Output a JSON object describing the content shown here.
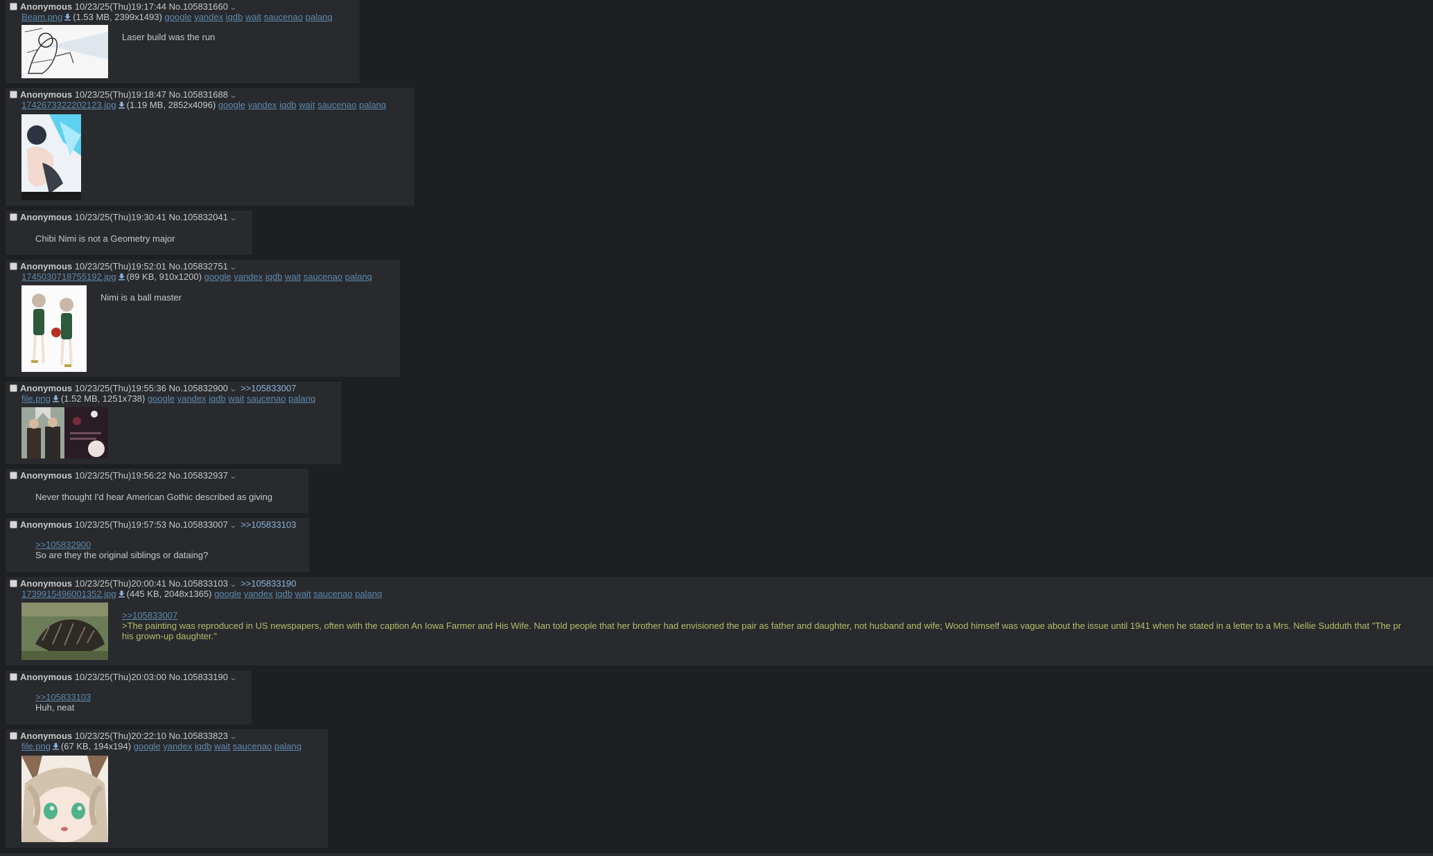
{
  "posts": [
    {
      "name": "Anonymous",
      "datetime": "10/23/25(Thu)19:17:44",
      "number": "No.105831660",
      "file": {
        "filename": "Beam.png",
        "info": "(1.53 MB, 2399x1493)"
      },
      "comment": "Laser build was the run"
    },
    {
      "name": "Anonymous",
      "datetime": "10/23/25(Thu)19:18:47",
      "number": "No.105831688",
      "file": {
        "filename": "1742673322202123.jpg",
        "info": "(1.19 MB, 2852x4096)"
      }
    },
    {
      "name": "Anonymous",
      "datetime": "10/23/25(Thu)19:30:41",
      "number": "No.105832041",
      "comment": "Chibi Nimi is not a Geometry major"
    },
    {
      "name": "Anonymous",
      "datetime": "10/23/25(Thu)19:52:01",
      "number": "No.105832751",
      "file": {
        "filename": "1745030718755192.jpg",
        "info": "(89 KB, 910x1200)"
      },
      "comment": "Nimi is a ball master"
    },
    {
      "name": "Anonymous",
      "datetime": "10/23/25(Thu)19:55:36",
      "number": "No.105832900",
      "backlink": ">>105833007",
      "file": {
        "filename": "file.png",
        "info": "(1.52 MB, 1251x738)"
      }
    },
    {
      "name": "Anonymous",
      "datetime": "10/23/25(Thu)19:56:22",
      "number": "No.105832937",
      "comment": "Never thought I'd hear American Gothic described as giving"
    },
    {
      "name": "Anonymous",
      "datetime": "10/23/25(Thu)19:57:53",
      "number": "No.105833007",
      "backlink": ">>105833103",
      "quote": ">>105832900",
      "comment": "So are they the original siblings or dataing?"
    },
    {
      "name": "Anonymous",
      "datetime": "10/23/25(Thu)20:00:41",
      "number": "No.105833103",
      "backlink": ">>105833190",
      "file": {
        "filename": "1739915496001352.jpg",
        "info": "(445 KB, 2048x1365)"
      },
      "quote": ">>105833007",
      "greentext": ">The painting was reproduced in US newspapers, often with the caption An Iowa Farmer and His Wife. Nan told people that her brother had envisioned the pair as father and daughter, not husband and wife; Wood himself was vague about the issue until 1941 when he stated in a letter to a Mrs. Nellie Sudduth that \"The pr",
      "greentext_cont": "his grown-up daughter.\""
    },
    {
      "name": "Anonymous",
      "datetime": "10/23/25(Thu)20:03:00",
      "number": "No.105833190",
      "quote": ">>105833103",
      "comment": "Huh, neat"
    },
    {
      "name": "Anonymous",
      "datetime": "10/23/25(Thu)20:22:10",
      "number": "No.105833823",
      "file": {
        "filename": "file.png",
        "info": "(67 KB, 194x194)"
      }
    }
  ],
  "search_links": [
    "google",
    "yandex",
    "iqdb",
    "wait",
    "saucenao",
    "palanq"
  ],
  "colors": {
    "background": "#1d1f21",
    "post_bg": "#282a2e",
    "link": "#5f89ac",
    "greentext": "#b5bd68",
    "text": "#c5c8c6"
  }
}
